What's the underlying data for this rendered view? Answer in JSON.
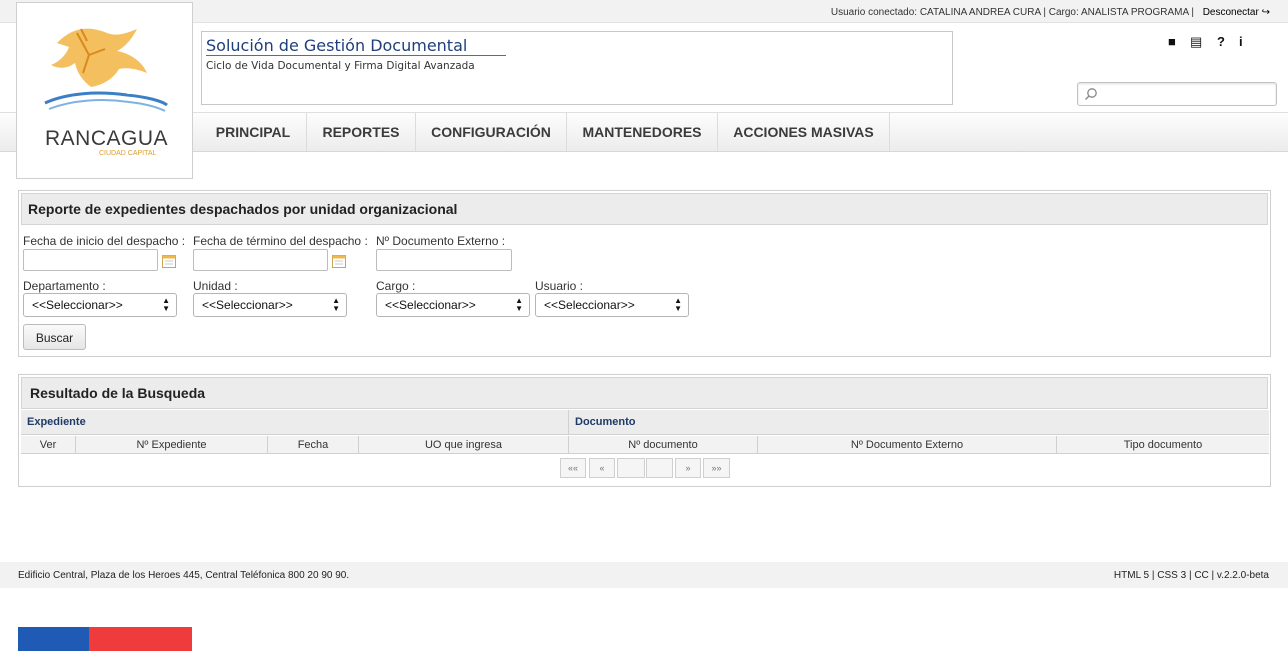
{
  "header": {
    "user_info": "Usuario conectado: CATALINA ANDREA CURA | Cargo: ANALISTA PROGRAMA |",
    "logout": "Desconectar",
    "logout_icon": "logout-arrow-icon",
    "logo": {
      "name": "RANCAGUA",
      "tagline": "CIUDAD CAPITAL"
    },
    "app_title": "Solución de Gestión Documental",
    "app_subtitle": "Ciclo de Vida Documental y Firma Digital Avanzada",
    "tool_icons": [
      "manual-book-icon",
      "newspaper-icon",
      "help-question-icon",
      "info-icon"
    ],
    "search_icon": "search-icon"
  },
  "nav": {
    "items": [
      "PRINCIPAL",
      "REPORTES",
      "CONFIGURACIÓN",
      "MANTENEDORES",
      "ACCIONES MASIVAS"
    ]
  },
  "report": {
    "title": "Reporte de expedientes despachados por unidad organizacional",
    "fecha_inicio_label": "Fecha de inicio del despacho :",
    "fecha_termino_label": "Fecha de término del despacho :",
    "doc_externo_label": "Nº Documento Externo :",
    "fecha_inicio_value": "",
    "fecha_termino_value": "",
    "doc_externo_value": "",
    "departamento_label": "Departamento :",
    "unidad_label": "Unidad :",
    "cargo_label": "Cargo :",
    "usuario_label": "Usuario :",
    "departamento_value": "<<Seleccionar>>",
    "unidad_value": "<<Seleccionar>>",
    "cargo_value": "<<Seleccionar>>",
    "usuario_value": "<<Seleccionar>>",
    "search_button": "Buscar"
  },
  "results": {
    "title": "Resultado de la Busqueda",
    "group_expediente": "Expediente",
    "group_documento": "Documento",
    "columns": [
      "Ver",
      "Nº Expediente",
      "Fecha",
      "UO que ingresa",
      "Nº documento",
      "Nº Documento Externo",
      "Tipo documento"
    ],
    "pager": [
      "««",
      "«",
      "",
      "",
      "»",
      "»»"
    ]
  },
  "footer": {
    "address": "Edificio Central, Plaza de los Heroes 445, Central Teléfonica 800 20 90 90.",
    "meta": "HTML 5 | CSS 3 | CC | v.2.2.0-beta"
  },
  "colors": {
    "flag_blue": "#1f5bb5",
    "flag_red": "#ef3b3b",
    "title_blue": "#1f3f7a"
  }
}
